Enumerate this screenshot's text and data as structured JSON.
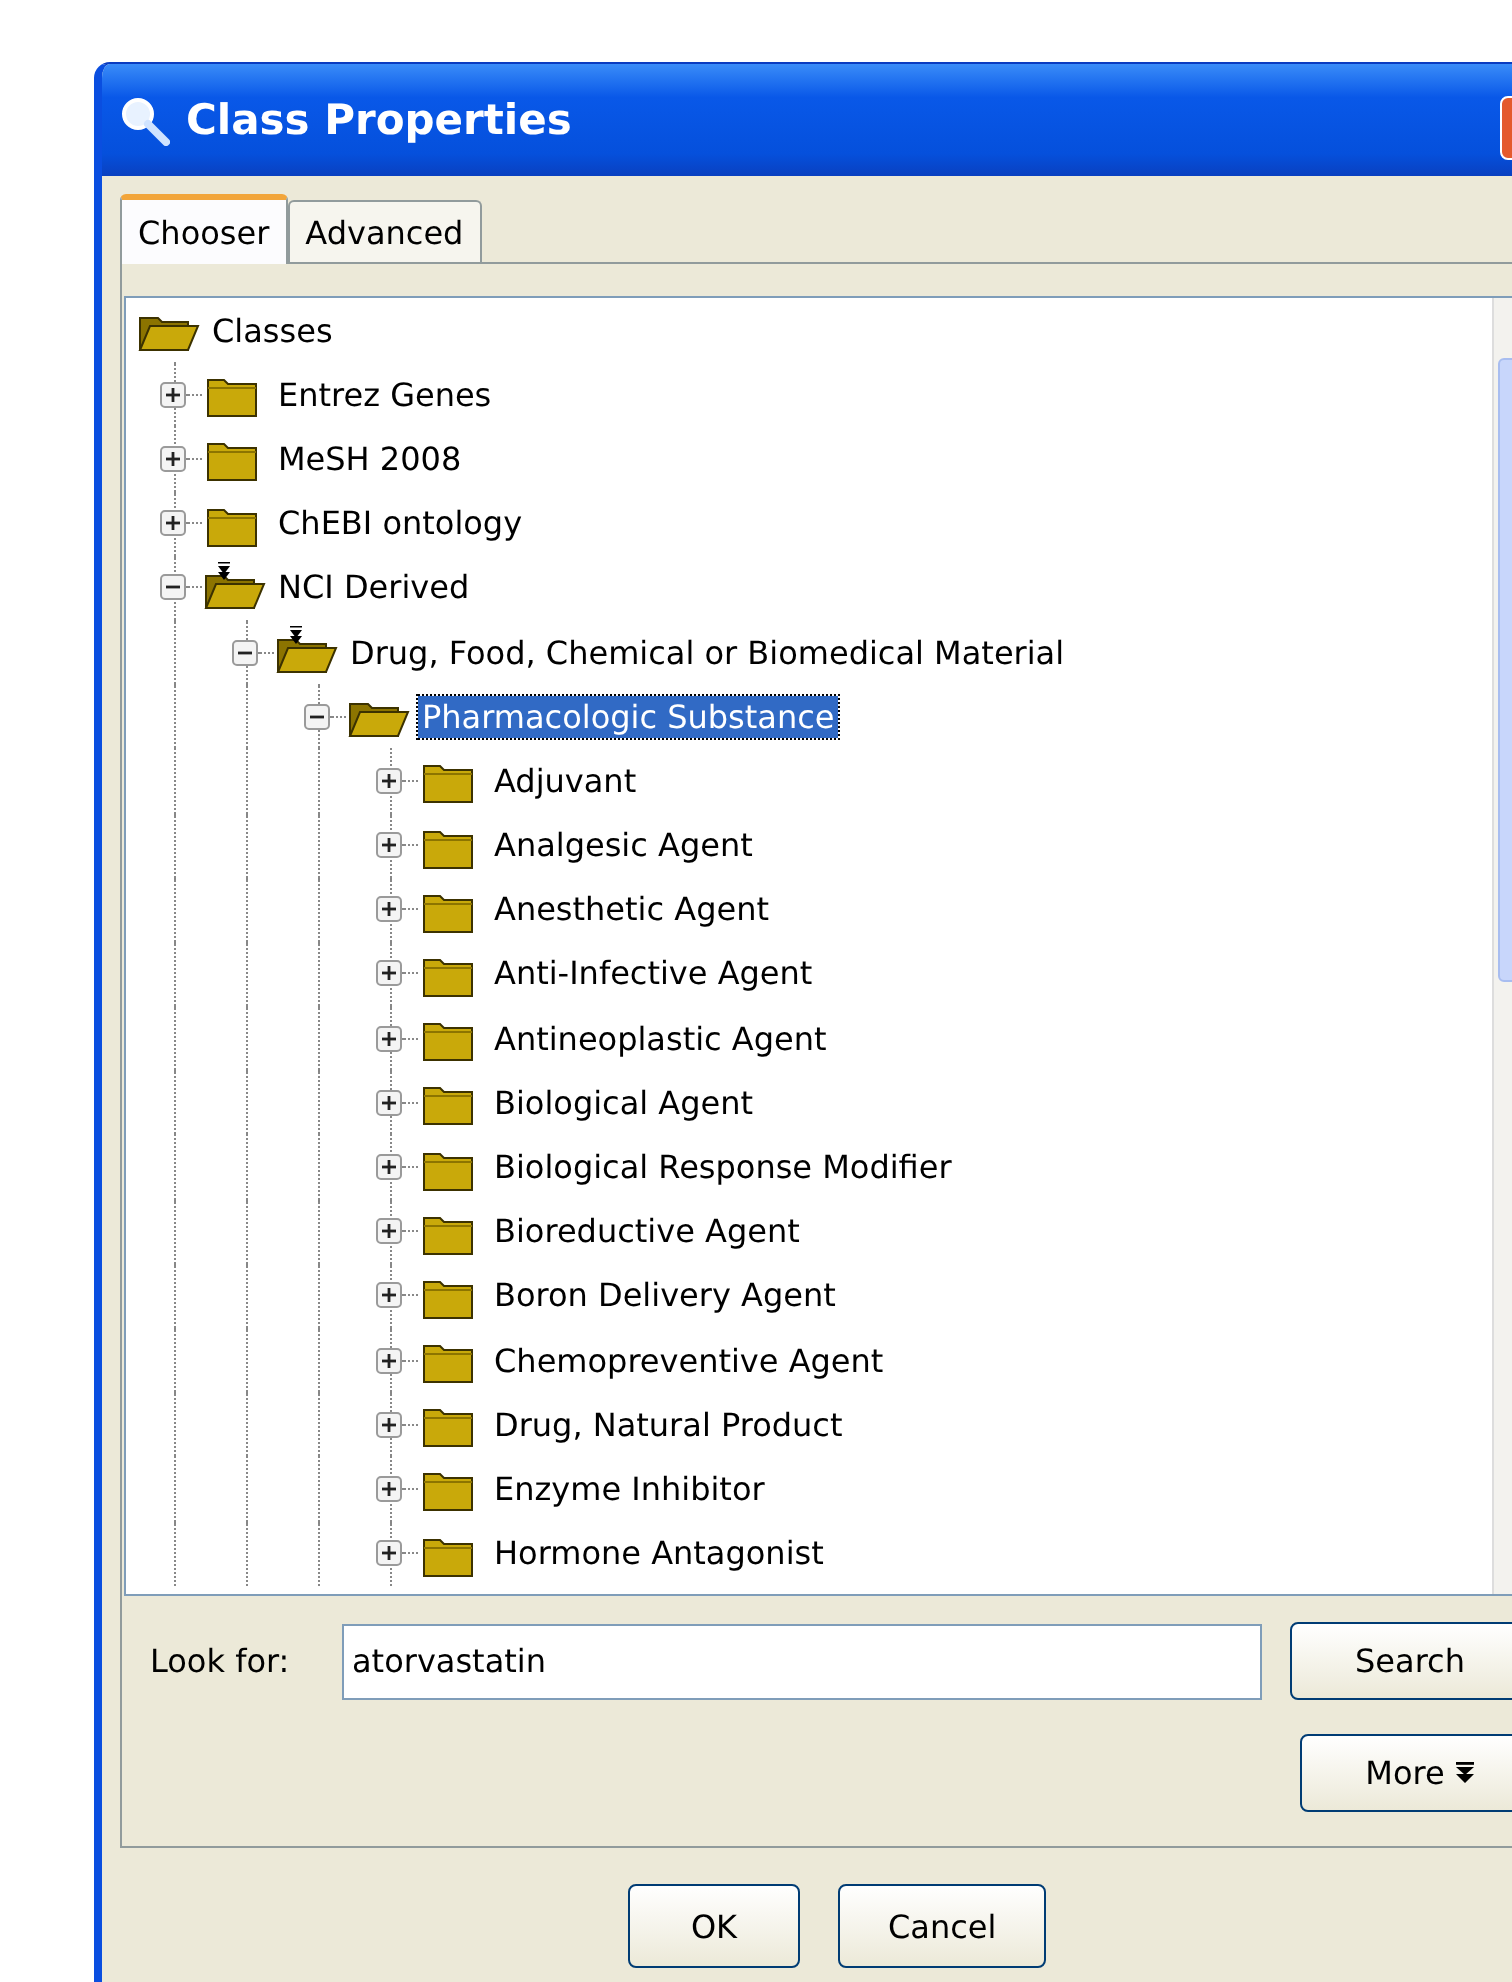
{
  "window": {
    "title": "Class Properties"
  },
  "tabs": [
    {
      "label": "Chooser",
      "selected": true
    },
    {
      "label": "Advanced",
      "selected": false
    }
  ],
  "tree": [
    {
      "label": "Classes",
      "expanded": true,
      "selected": false,
      "filtered": false,
      "children": [
        {
          "label": "Entrez Genes",
          "expanded": false,
          "selected": false,
          "filtered": false
        },
        {
          "label": "MeSH 2008",
          "expanded": false,
          "selected": false,
          "filtered": false
        },
        {
          "label": "ChEBI ontology",
          "expanded": false,
          "selected": false,
          "filtered": false
        },
        {
          "label": "NCI Derived",
          "expanded": true,
          "selected": false,
          "filtered": true,
          "children": [
            {
              "label": "Drug, Food, Chemical or Biomedical Material",
              "expanded": true,
              "selected": false,
              "filtered": true,
              "children": [
                {
                  "label": "Pharmacologic Substance",
                  "expanded": true,
                  "selected": true,
                  "filtered": false,
                  "children": [
                    {
                      "label": "Adjuvant",
                      "expanded": false,
                      "selected": false,
                      "filtered": false
                    },
                    {
                      "label": "Analgesic Agent",
                      "expanded": false,
                      "selected": false,
                      "filtered": false
                    },
                    {
                      "label": "Anesthetic Agent",
                      "expanded": false,
                      "selected": false,
                      "filtered": false
                    },
                    {
                      "label": "Anti-Infective Agent",
                      "expanded": false,
                      "selected": false,
                      "filtered": false
                    },
                    {
                      "label": "Antineoplastic Agent",
                      "expanded": false,
                      "selected": false,
                      "filtered": false
                    },
                    {
                      "label": "Biological Agent",
                      "expanded": false,
                      "selected": false,
                      "filtered": false
                    },
                    {
                      "label": "Biological Response Modifier",
                      "expanded": false,
                      "selected": false,
                      "filtered": false
                    },
                    {
                      "label": "Bioreductive Agent",
                      "expanded": false,
                      "selected": false,
                      "filtered": false
                    },
                    {
                      "label": "Boron Delivery Agent",
                      "expanded": false,
                      "selected": false,
                      "filtered": false
                    },
                    {
                      "label": "Chemopreventive Agent",
                      "expanded": false,
                      "selected": false,
                      "filtered": false
                    },
                    {
                      "label": "Drug, Natural Product",
                      "expanded": false,
                      "selected": false,
                      "filtered": false
                    },
                    {
                      "label": "Enzyme Inhibitor",
                      "expanded": false,
                      "selected": false,
                      "filtered": false
                    },
                    {
                      "label": "Hormone Antagonist",
                      "expanded": false,
                      "selected": false,
                      "filtered": false
                    }
                  ]
                }
              ]
            }
          ]
        }
      ]
    }
  ],
  "search": {
    "label": "Look for:",
    "value": "atorvastatin",
    "button": "Search"
  },
  "more_button": "More",
  "buttons": [
    "OK",
    "Cancel"
  ]
}
